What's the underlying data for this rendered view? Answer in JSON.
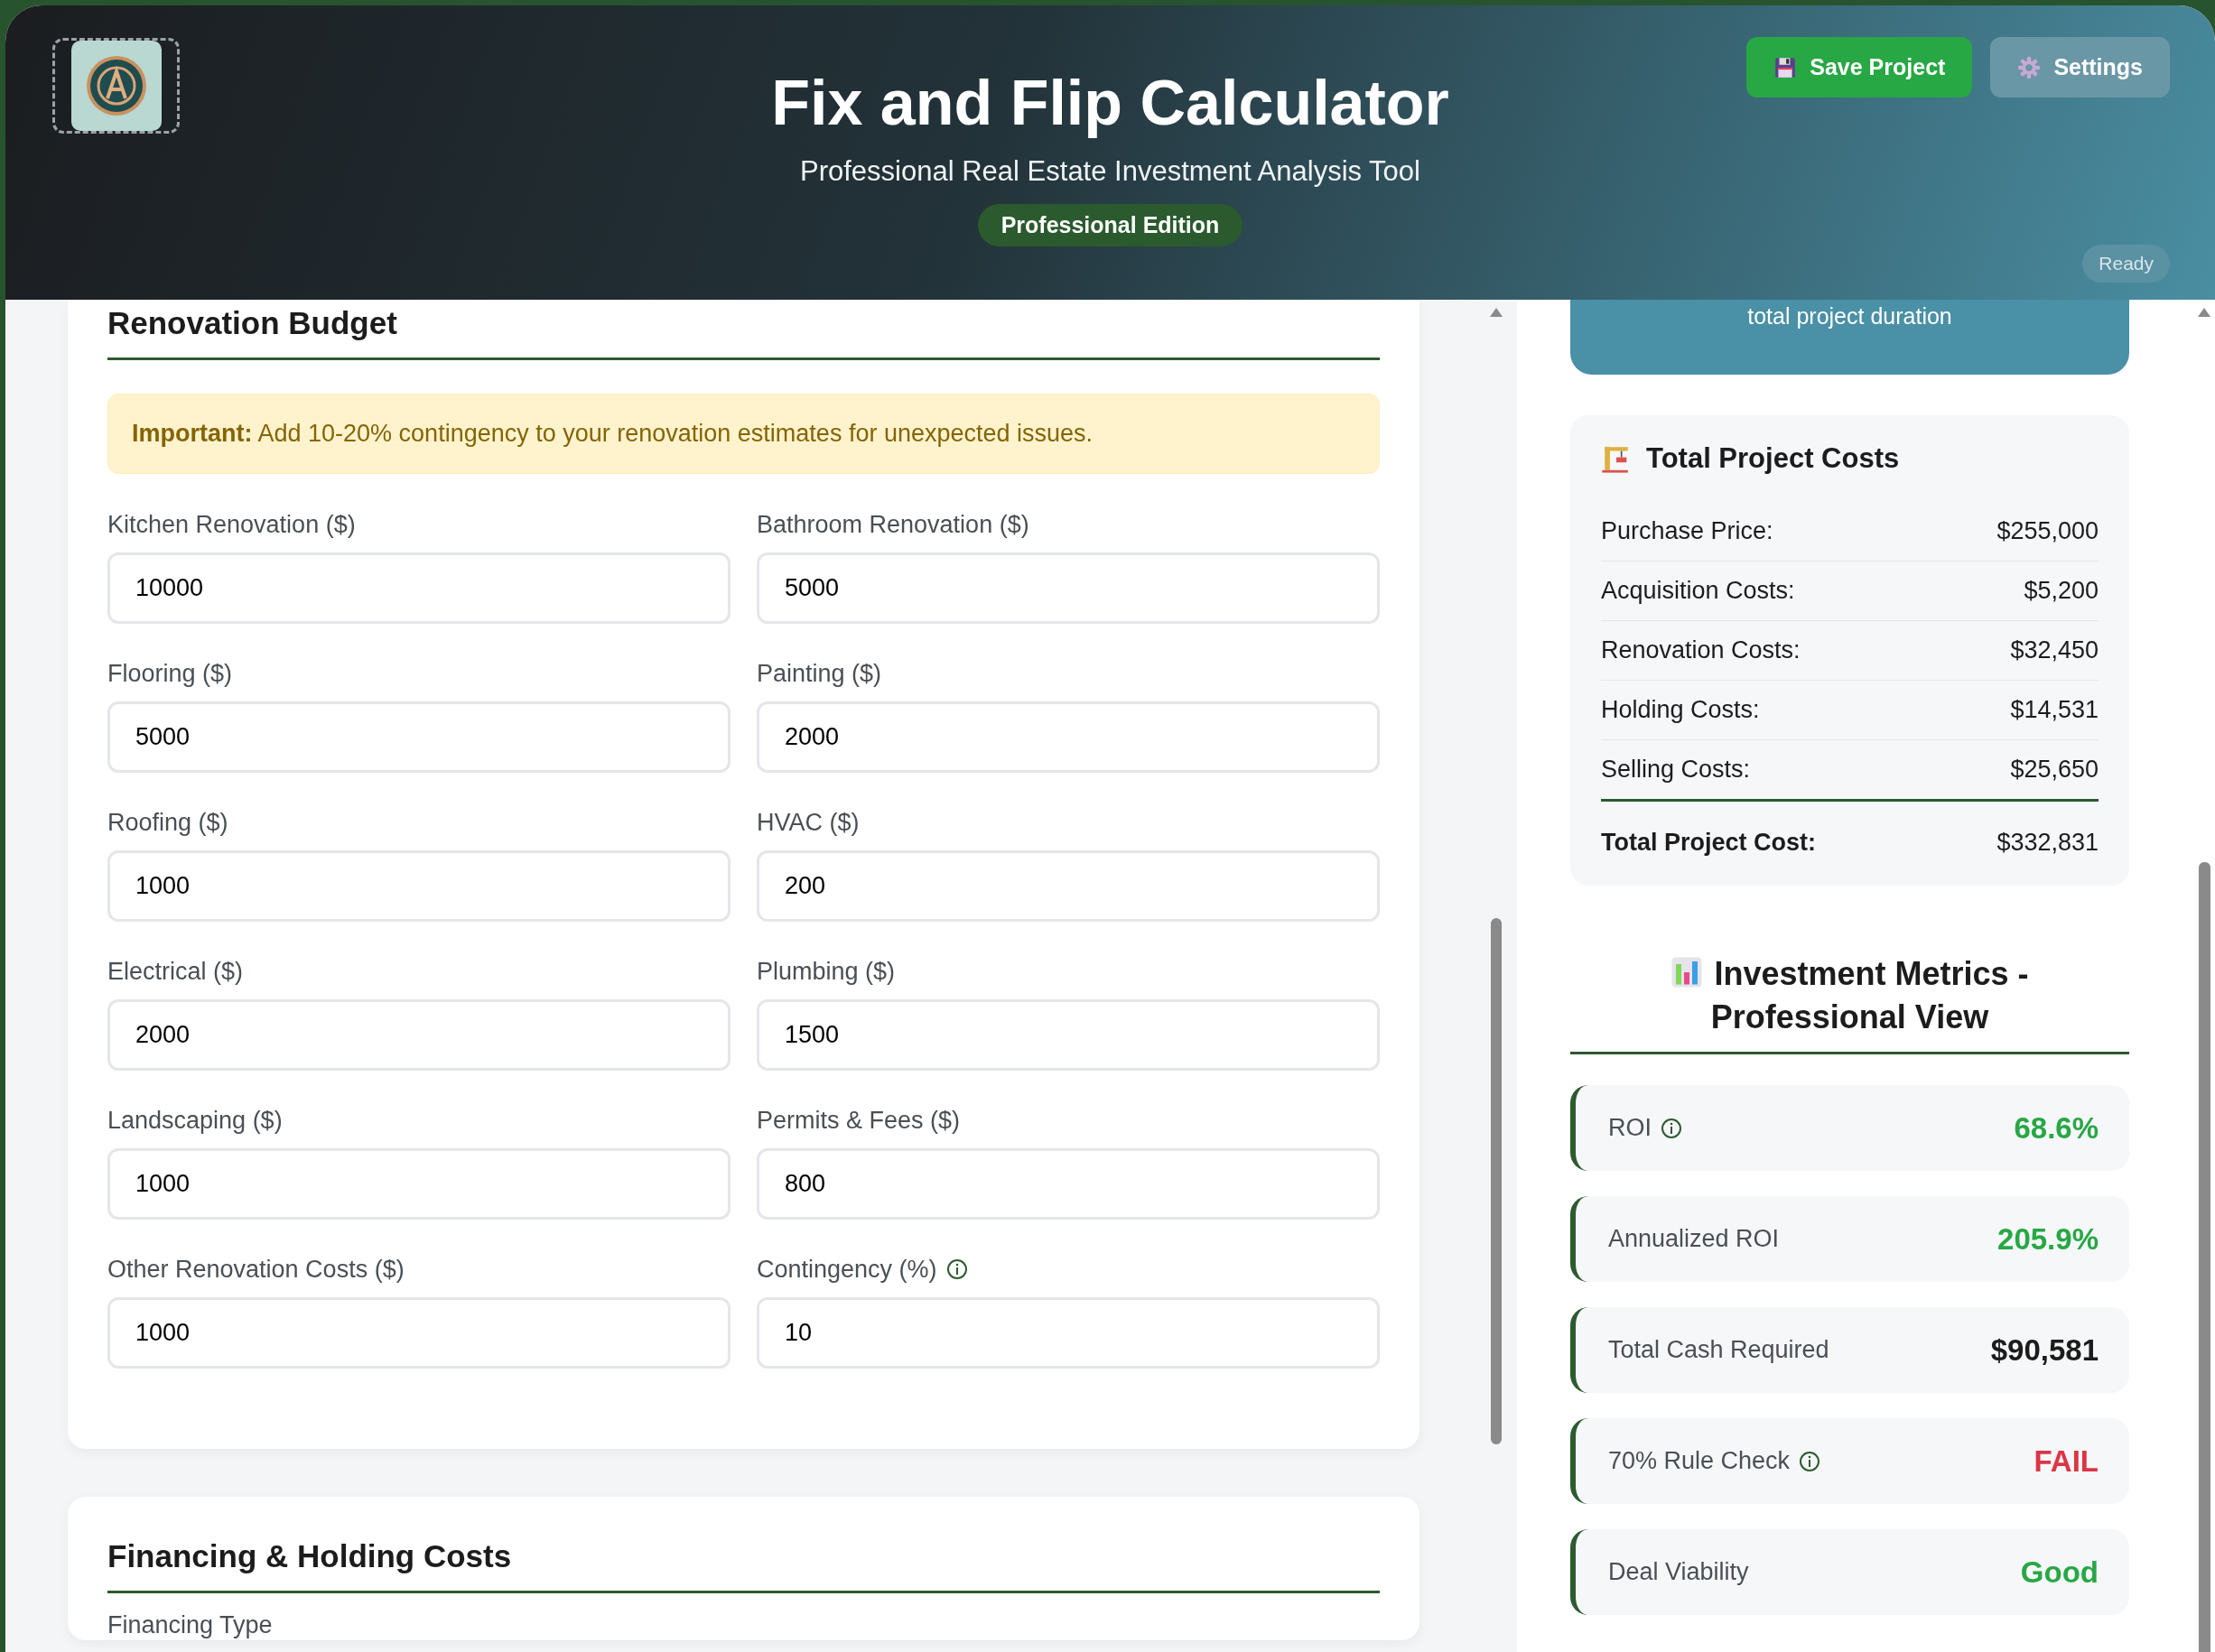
{
  "header": {
    "title": "Fix and Flip Calculator",
    "subtitle": "Professional Real Estate Investment Analysis Tool",
    "edition_badge": "Professional Edition",
    "buttons": [
      {
        "label": "Save Project",
        "kind": "primary"
      },
      {
        "label": "Settings",
        "kind": "secondary"
      }
    ],
    "status": "Ready"
  },
  "renovation_section": {
    "title": "Renovation Budget",
    "alert": "**Important:** Add 10-20% contingency to your renovation estimates for unexpected issues.",
    "fields": [
      {
        "label": "Kitchen Renovation ($)",
        "value": "10000",
        "info": false
      },
      {
        "label": "Bathroom Renovation ($)",
        "value": "5000",
        "info": false
      },
      {
        "label": "Flooring ($)",
        "value": "5000",
        "info": false
      },
      {
        "label": "Painting ($)",
        "value": "2000",
        "info": false
      },
      {
        "label": "Roofing ($)",
        "value": "1000",
        "info": false
      },
      {
        "label": "HVAC ($)",
        "value": "200",
        "info": false
      },
      {
        "label": "Electrical ($)",
        "value": "2000",
        "info": false
      },
      {
        "label": "Plumbing ($)",
        "value": "1500",
        "info": false
      },
      {
        "label": "Landscaping ($)",
        "value": "1000",
        "info": false
      },
      {
        "label": "Permits & Fees ($)",
        "value": "800",
        "info": false
      },
      {
        "label": "Other Renovation Costs ($)",
        "value": "1000",
        "info": false
      },
      {
        "label": "Contingency (%)",
        "value": "10",
        "info": true
      }
    ]
  },
  "financing_section": {
    "title": "Financing & Holding Costs",
    "first_label": "Financing Type"
  },
  "timeline_card": {
    "text": "total project duration"
  },
  "costs_card": {
    "title": "Total Project Costs",
    "rows": [
      {
        "label": "Purchase Price:",
        "value": "$255,000"
      },
      {
        "label": "Acquisition Costs:",
        "value": "$5,200"
      },
      {
        "label": "Renovation Costs:",
        "value": "$32,450"
      },
      {
        "label": "Holding Costs:",
        "value": "$14,531"
      },
      {
        "label": "Selling Costs:",
        "value": "$25,650"
      }
    ],
    "total": {
      "label": "Total Project Cost:",
      "value": "$332,831"
    }
  },
  "metrics": {
    "title": "Investment Metrics - Professional View",
    "items": [
      {
        "label": "ROI",
        "value": "68.6%",
        "info": true,
        "color": "#28a745"
      },
      {
        "label": "Annualized ROI",
        "value": "205.9%",
        "info": false,
        "color": "#28a745"
      },
      {
        "label": "Total Cash Required",
        "value": "$90,581",
        "info": false,
        "color": "#1c1c1c"
      },
      {
        "label": "70% Rule Check",
        "value": "FAIL",
        "info": true,
        "color": "#dc3545"
      },
      {
        "label": "Deal Viability",
        "value": "Good",
        "info": false,
        "color": "#28a745"
      }
    ]
  }
}
